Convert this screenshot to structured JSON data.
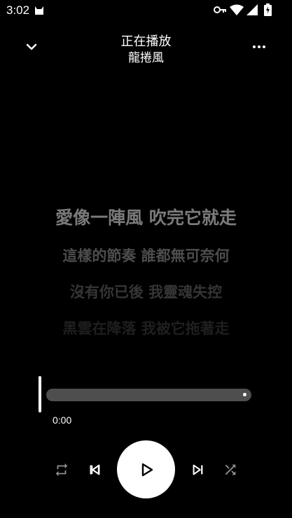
{
  "status_bar": {
    "time": "3:02"
  },
  "header": {
    "title": "正在播放",
    "subtitle": "龍捲風"
  },
  "lyrics": [
    "愛像一陣風 吹完它就走",
    "這樣的節奏 誰都無可奈何",
    "沒有你已後 我靈魂失控",
    "黑雲在降落 我被它拖著走"
  ],
  "player": {
    "elapsed": "0:00",
    "progress_fraction": 0.0
  },
  "icons": {
    "collapse": "chevron-down-icon",
    "more": "more-horizontal-icon",
    "repeat": "repeat-icon",
    "previous": "skip-previous-icon",
    "play": "play-icon",
    "next": "skip-next-icon",
    "shuffle": "shuffle-icon"
  },
  "colors": {
    "background": "#000000",
    "track": "#4e4e4e",
    "accent": "#ffffff"
  }
}
